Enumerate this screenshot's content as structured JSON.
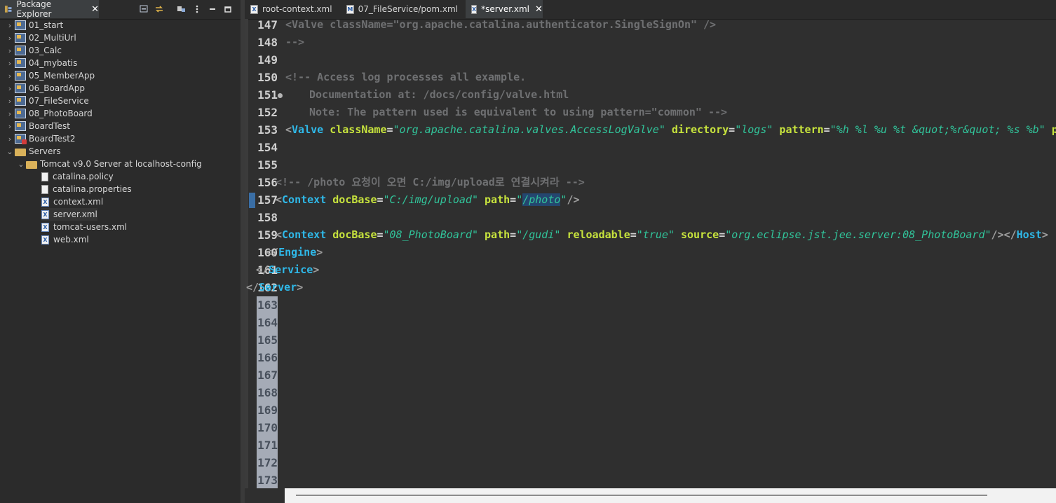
{
  "explorer": {
    "title": "Package Explorer",
    "close_label": "✕",
    "items": [
      {
        "label": "01_start",
        "kind": "project"
      },
      {
        "label": "02_MultiUrl",
        "kind": "project"
      },
      {
        "label": "03_Calc",
        "kind": "project"
      },
      {
        "label": "04_mybatis",
        "kind": "project"
      },
      {
        "label": "05_MemberApp",
        "kind": "project"
      },
      {
        "label": "06_BoardApp",
        "kind": "project"
      },
      {
        "label": "07_FileService",
        "kind": "project"
      },
      {
        "label": "08_PhotoBoard",
        "kind": "project"
      },
      {
        "label": "BoardTest",
        "kind": "project"
      },
      {
        "label": "BoardTest2",
        "kind": "project-error"
      },
      {
        "label": "Servers",
        "kind": "folder-open"
      },
      {
        "label": "Tomcat v9.0 Server at localhost-config",
        "kind": "folder-open"
      },
      {
        "label": "catalina.policy",
        "kind": "file"
      },
      {
        "label": "catalina.properties",
        "kind": "file"
      },
      {
        "label": "context.xml",
        "kind": "xml"
      },
      {
        "label": "server.xml",
        "kind": "xml"
      },
      {
        "label": "tomcat-users.xml",
        "kind": "xml"
      },
      {
        "label": "web.xml",
        "kind": "xml"
      }
    ]
  },
  "editor": {
    "tabs": [
      {
        "label": "root-context.xml",
        "icon": "X"
      },
      {
        "label": "07_FileService/pom.xml",
        "icon": "M"
      },
      {
        "label": "*server.xml",
        "icon": "X",
        "close": "✕"
      }
    ],
    "line_numbers": [
      "147",
      "148",
      "149",
      "150",
      "151",
      "152",
      "153",
      "154",
      "155",
      "156",
      "157",
      "158",
      "159",
      "160",
      "161",
      "162",
      "163",
      "164",
      "165",
      "166",
      "167",
      "168",
      "169",
      "170",
      "171",
      "172",
      "173"
    ],
    "lines": {
      "l147": "<Valve className=\"org.apache.catalina.authenticator.SingleSignOn\" />",
      "l148": "-->",
      "l150": "<!-- Access log processes all example.",
      "l151": "Documentation at: /docs/config/valve.html",
      "l152": "Note: The pattern used is equivalent to using pattern=\"common\" -->",
      "l156": "<!-- /photo 요청이 오면 C:/img/upload로 연결시켜라 -->"
    },
    "tokens": {
      "valve_tag": "Valve",
      "valve_classname_attr": "className",
      "valve_classname_val": "\"org.apache.catalina.valves.AccessLogValve\"",
      "valve_directory_attr": "directory",
      "valve_directory_val": "\"logs\"",
      "valve_pattern_attr": "pattern",
      "valve_pattern_val": "\"%h %l %u %t &quot;%r&quot; %s %b\"",
      "valve_trailing": "pr",
      "context_tag": "Context",
      "docbase_attr": "docBase",
      "docbase1_val": "\"C:/img/upload\"",
      "path_attr": "path",
      "path1_q1": "\"",
      "path1_sel": "/photo",
      "path1_q2": "\"",
      "docbase2_val": "\"08_PhotoBoard\"",
      "path2_val": "\"/gudi\"",
      "reloadable_attr": "reloadable",
      "reloadable_val": "\"true\"",
      "source_attr": "source",
      "source_val": "\"org.eclipse.jst.jee.server:08_PhotoBoard\"",
      "host_tag": "Host",
      "engine_tag": "Engine",
      "service_tag": "Service",
      "server_tag": "Server"
    }
  }
}
